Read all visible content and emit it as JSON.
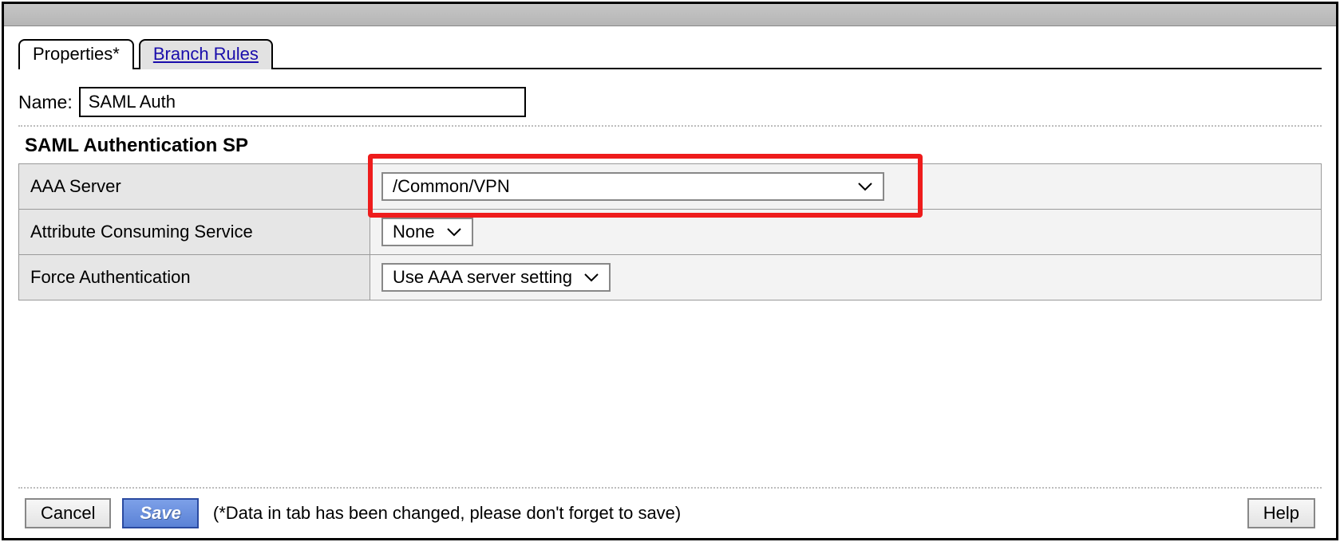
{
  "tabs": {
    "properties": "Properties*",
    "branch_rules": "Branch Rules"
  },
  "name": {
    "label": "Name:",
    "value": "SAML Auth"
  },
  "section_title": "SAML Authentication SP",
  "rows": {
    "aaa_server": {
      "label": "AAA Server",
      "value": "/Common/VPN"
    },
    "acs": {
      "label": "Attribute Consuming Service",
      "value": "None"
    },
    "force_auth": {
      "label": "Force Authentication",
      "value": "Use AAA server setting"
    }
  },
  "footer": {
    "cancel": "Cancel",
    "save": "Save",
    "hint": "(*Data in tab has been changed, please don't forget to save)",
    "help": "Help"
  }
}
